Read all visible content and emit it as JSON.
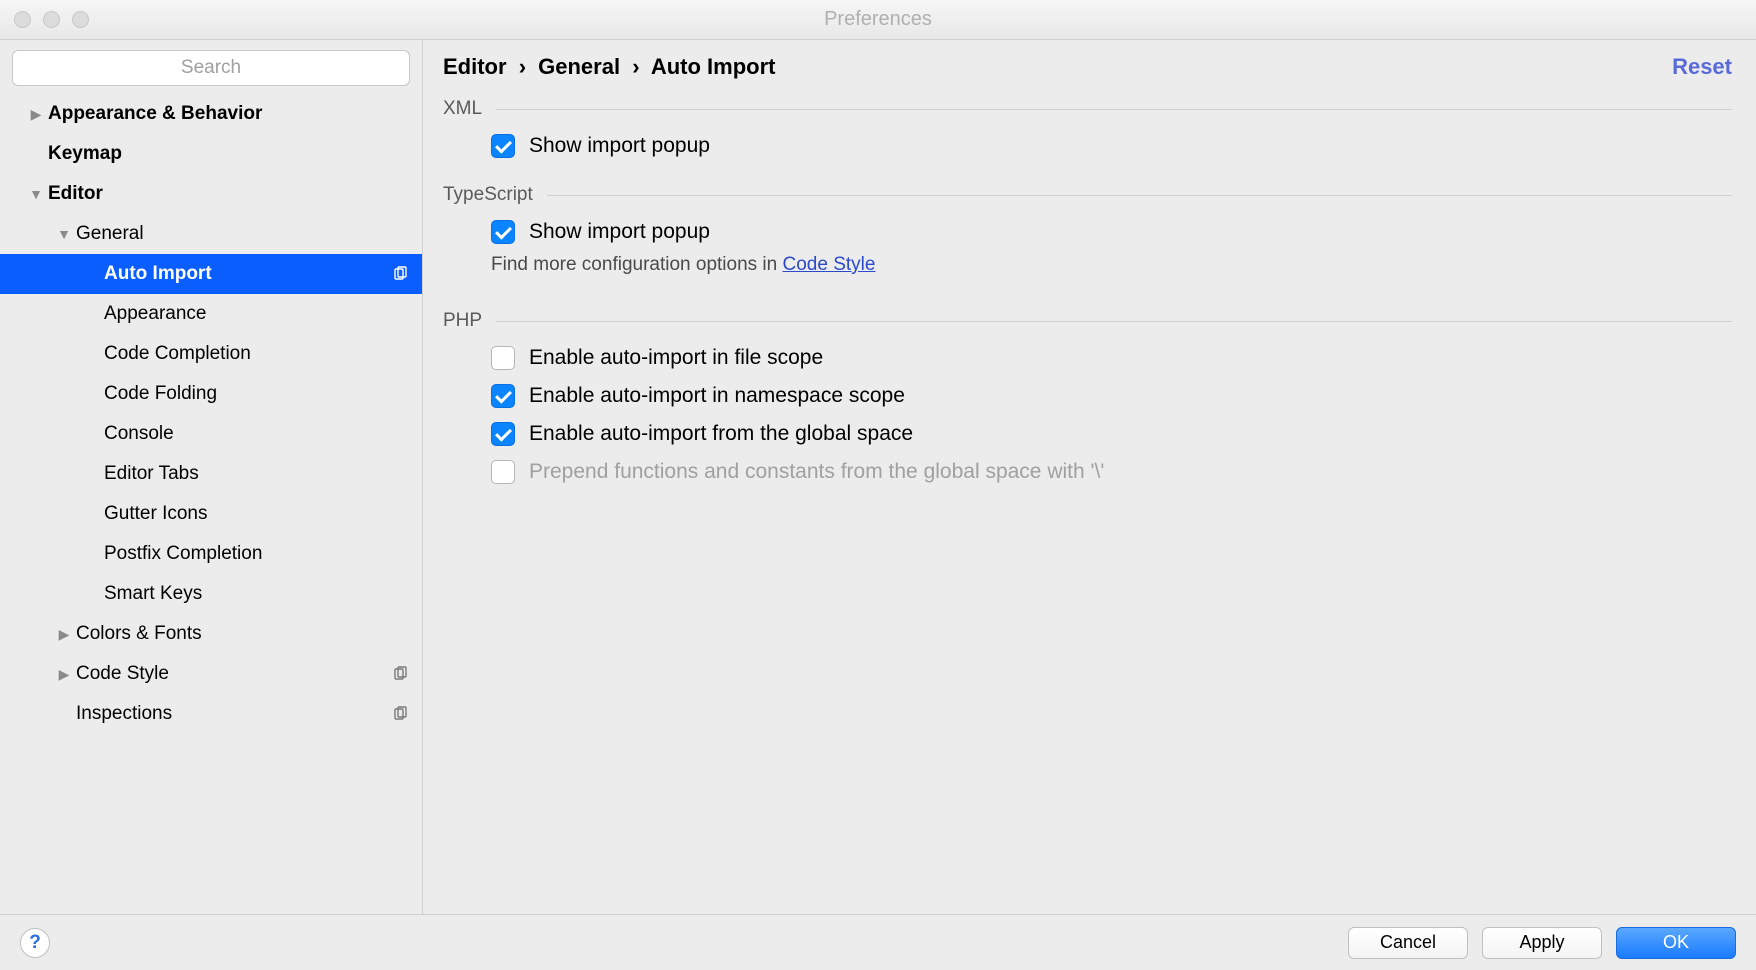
{
  "window": {
    "title": "Preferences"
  },
  "search": {
    "placeholder": "Search"
  },
  "sidebar": [
    {
      "label": "Appearance & Behavior",
      "level": 0,
      "bold": true,
      "arrow": "right",
      "selected": false,
      "copyIcon": false
    },
    {
      "label": "Keymap",
      "level": 0,
      "bold": true,
      "arrow": "none",
      "selected": false,
      "copyIcon": false
    },
    {
      "label": "Editor",
      "level": 0,
      "bold": true,
      "arrow": "down",
      "selected": false,
      "copyIcon": false
    },
    {
      "label": "General",
      "level": 1,
      "bold": false,
      "arrow": "down",
      "selected": false,
      "copyIcon": false
    },
    {
      "label": "Auto Import",
      "level": 2,
      "bold": false,
      "arrow": "none",
      "selected": true,
      "copyIcon": true
    },
    {
      "label": "Appearance",
      "level": 2,
      "bold": false,
      "arrow": "none",
      "selected": false,
      "copyIcon": false
    },
    {
      "label": "Code Completion",
      "level": 2,
      "bold": false,
      "arrow": "none",
      "selected": false,
      "copyIcon": false
    },
    {
      "label": "Code Folding",
      "level": 2,
      "bold": false,
      "arrow": "none",
      "selected": false,
      "copyIcon": false
    },
    {
      "label": "Console",
      "level": 2,
      "bold": false,
      "arrow": "none",
      "selected": false,
      "copyIcon": false
    },
    {
      "label": "Editor Tabs",
      "level": 2,
      "bold": false,
      "arrow": "none",
      "selected": false,
      "copyIcon": false
    },
    {
      "label": "Gutter Icons",
      "level": 2,
      "bold": false,
      "arrow": "none",
      "selected": false,
      "copyIcon": false
    },
    {
      "label": "Postfix Completion",
      "level": 2,
      "bold": false,
      "arrow": "none",
      "selected": false,
      "copyIcon": false
    },
    {
      "label": "Smart Keys",
      "level": 2,
      "bold": false,
      "arrow": "none",
      "selected": false,
      "copyIcon": false
    },
    {
      "label": "Colors & Fonts",
      "level": 1,
      "bold": false,
      "arrow": "right",
      "selected": false,
      "copyIcon": false
    },
    {
      "label": "Code Style",
      "level": 1,
      "bold": false,
      "arrow": "right",
      "selected": false,
      "copyIcon": true
    },
    {
      "label": "Inspections",
      "level": 1,
      "bold": false,
      "arrow": "none",
      "selected": false,
      "copyIcon": true
    }
  ],
  "breadcrumb": {
    "p0": "Editor",
    "p1": "General",
    "p2": "Auto Import"
  },
  "resetLabel": "Reset",
  "sections": {
    "xml": {
      "title": "XML",
      "opt0": {
        "label": "Show import popup",
        "checked": true,
        "disabled": false
      }
    },
    "ts": {
      "title": "TypeScript",
      "opt0": {
        "label": "Show import popup",
        "checked": true,
        "disabled": false
      },
      "subtextPrefix": "Find more configuration options in ",
      "subtextLink": "Code Style"
    },
    "php": {
      "title": "PHP",
      "opt0": {
        "label": "Enable auto-import in file scope",
        "checked": false,
        "disabled": false
      },
      "opt1": {
        "label": "Enable auto-import in namespace scope",
        "checked": true,
        "disabled": false
      },
      "opt2": {
        "label": "Enable auto-import from the global space",
        "checked": true,
        "disabled": false
      },
      "opt3": {
        "label": "Prepend functions and constants from the global space with '\\'",
        "checked": false,
        "disabled": true
      }
    }
  },
  "footer": {
    "help": "?",
    "cancel": "Cancel",
    "apply": "Apply",
    "ok": "OK"
  }
}
